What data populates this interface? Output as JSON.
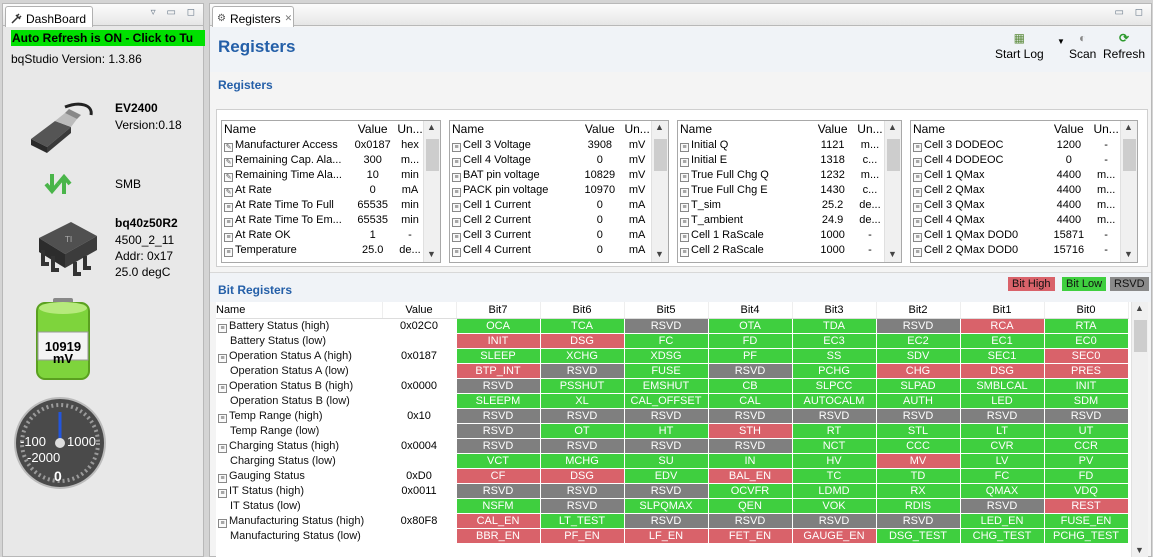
{
  "left": {
    "tab_label": "DashBoard",
    "auto_refresh": "Auto Refresh is ON - Click to Tu",
    "studio_version": "bqStudio Version: 1.3.86",
    "adapter": {
      "name": "EV2400",
      "version": "Version:0.18"
    },
    "bus": "SMB",
    "device": {
      "name": "bq40z50R2",
      "fw": "4500_2_11",
      "addr": "Addr: 0x17",
      "temp": "25.0 degC"
    },
    "voltage": {
      "value": "10919",
      "unit": "mV"
    },
    "current_gauge": {
      "left": "-100",
      "right": "1000",
      "bottom_label": "-2000",
      "value": "0"
    }
  },
  "right": {
    "tab_label": "Registers",
    "title": "Registers",
    "toolbar": {
      "start_log": "Start Log",
      "scan": "Scan",
      "refresh": "Refresh"
    },
    "registers_section": "Registers",
    "col_headers": {
      "name": "Name",
      "value": "Value",
      "unit": "Un..."
    },
    "reg_tables": [
      {
        "rows": [
          {
            "name": "Manufacturer Access",
            "value": "0x0187",
            "unit": "hex",
            "icon": "edit"
          },
          {
            "name": "Remaining Cap. Ala...",
            "value": "300",
            "unit": "m...",
            "icon": "edit"
          },
          {
            "name": "Remaining Time Ala...",
            "value": "10",
            "unit": "min",
            "icon": "edit"
          },
          {
            "name": "At Rate",
            "value": "0",
            "unit": "mA",
            "icon": "edit"
          },
          {
            "name": "At Rate Time To Full",
            "value": "65535",
            "unit": "min",
            "icon": "ro"
          },
          {
            "name": "At Rate Time To Em...",
            "value": "65535",
            "unit": "min",
            "icon": "ro"
          },
          {
            "name": "At Rate OK",
            "value": "1",
            "unit": "-",
            "icon": "ro"
          },
          {
            "name": "Temperature",
            "value": "25.0",
            "unit": "de...",
            "icon": "ro"
          }
        ]
      },
      {
        "rows": [
          {
            "name": "Cell 3 Voltage",
            "value": "3908",
            "unit": "mV",
            "icon": "ro"
          },
          {
            "name": "Cell 4 Voltage",
            "value": "0",
            "unit": "mV",
            "icon": "ro"
          },
          {
            "name": "BAT pin voltage",
            "value": "10829",
            "unit": "mV",
            "icon": "ro"
          },
          {
            "name": "PACK pin voltage",
            "value": "10970",
            "unit": "mV",
            "icon": "ro"
          },
          {
            "name": "Cell 1 Current",
            "value": "0",
            "unit": "mA",
            "icon": "ro"
          },
          {
            "name": "Cell 2 Current",
            "value": "0",
            "unit": "mA",
            "icon": "ro"
          },
          {
            "name": "Cell 3 Current",
            "value": "0",
            "unit": "mA",
            "icon": "ro"
          },
          {
            "name": "Cell 4 Current",
            "value": "0",
            "unit": "mA",
            "icon": "ro"
          }
        ]
      },
      {
        "rows": [
          {
            "name": "Initial Q",
            "value": "1121",
            "unit": "m...",
            "icon": "ro"
          },
          {
            "name": "Initial E",
            "value": "1318",
            "unit": "c...",
            "icon": "ro"
          },
          {
            "name": "True Full Chg Q",
            "value": "1232",
            "unit": "m...",
            "icon": "ro"
          },
          {
            "name": "True Full Chg E",
            "value": "1430",
            "unit": "c...",
            "icon": "ro"
          },
          {
            "name": "T_sim",
            "value": "25.2",
            "unit": "de...",
            "icon": "ro"
          },
          {
            "name": "T_ambient",
            "value": "24.9",
            "unit": "de...",
            "icon": "ro"
          },
          {
            "name": "Cell 1 RaScale",
            "value": "1000",
            "unit": "-",
            "icon": "ro"
          },
          {
            "name": "Cell 2 RaScale",
            "value": "1000",
            "unit": "-",
            "icon": "ro"
          }
        ]
      },
      {
        "rows": [
          {
            "name": "Cell 3 DODEOC",
            "value": "1200",
            "unit": "-",
            "icon": "ro"
          },
          {
            "name": "Cell 4 DODEOC",
            "value": "0",
            "unit": "-",
            "icon": "ro"
          },
          {
            "name": "Cell 1 QMax",
            "value": "4400",
            "unit": "m...",
            "icon": "ro"
          },
          {
            "name": "Cell 2 QMax",
            "value": "4400",
            "unit": "m...",
            "icon": "ro"
          },
          {
            "name": "Cell 3 QMax",
            "value": "4400",
            "unit": "m...",
            "icon": "ro"
          },
          {
            "name": "Cell 4 QMax",
            "value": "4400",
            "unit": "m...",
            "icon": "ro"
          },
          {
            "name": "Cell 1 QMax DOD0",
            "value": "15871",
            "unit": "-",
            "icon": "ro"
          },
          {
            "name": "Cell 2 QMax DOD0",
            "value": "15716",
            "unit": "-",
            "icon": "ro"
          }
        ]
      }
    ],
    "bit_section": "Bit Registers",
    "legend": {
      "high": "Bit High",
      "low": "Bit Low",
      "rsvd": "RSVD",
      "colors": {
        "high": "#d9626a",
        "low": "#3fcf3f",
        "rsvd": "#7f7f7f"
      }
    },
    "bit_headers": [
      "Name",
      "Value",
      "Bit7",
      "Bit6",
      "Bit5",
      "Bit4",
      "Bit3",
      "Bit2",
      "Bit1",
      "Bit0"
    ],
    "bit_rows": [
      {
        "name": "Battery Status (high)",
        "value": "0x02C0",
        "top": true,
        "bits": [
          [
            "OCA",
            "g"
          ],
          [
            "TCA",
            "g"
          ],
          [
            "RSVD",
            "y"
          ],
          [
            "OTA",
            "g"
          ],
          [
            "TDA",
            "g"
          ],
          [
            "RSVD",
            "y"
          ],
          [
            "RCA",
            "r"
          ],
          [
            "RTA",
            "g"
          ]
        ]
      },
      {
        "name": "Battery Status (low)",
        "value": "",
        "top": false,
        "bits": [
          [
            "INIT",
            "r"
          ],
          [
            "DSG",
            "r"
          ],
          [
            "FC",
            "g"
          ],
          [
            "FD",
            "g"
          ],
          [
            "EC3",
            "g"
          ],
          [
            "EC2",
            "g"
          ],
          [
            "EC1",
            "g"
          ],
          [
            "EC0",
            "g"
          ]
        ]
      },
      {
        "name": "Operation Status A (high)",
        "value": "0x0187",
        "top": true,
        "bits": [
          [
            "SLEEP",
            "g"
          ],
          [
            "XCHG",
            "g"
          ],
          [
            "XDSG",
            "g"
          ],
          [
            "PF",
            "g"
          ],
          [
            "SS",
            "g"
          ],
          [
            "SDV",
            "g"
          ],
          [
            "SEC1",
            "g"
          ],
          [
            "SEC0",
            "r"
          ]
        ]
      },
      {
        "name": "Operation Status A (low)",
        "value": "",
        "top": false,
        "bits": [
          [
            "BTP_INT",
            "r"
          ],
          [
            "RSVD",
            "y"
          ],
          [
            "FUSE",
            "g"
          ],
          [
            "RSVD",
            "y"
          ],
          [
            "PCHG",
            "g"
          ],
          [
            "CHG",
            "r"
          ],
          [
            "DSG",
            "r"
          ],
          [
            "PRES",
            "r"
          ]
        ]
      },
      {
        "name": "Operation Status B (high)",
        "value": "0x0000",
        "top": true,
        "bits": [
          [
            "RSVD",
            "y"
          ],
          [
            "PSSHUT",
            "g"
          ],
          [
            "EMSHUT",
            "g"
          ],
          [
            "CB",
            "g"
          ],
          [
            "SLPCC",
            "g"
          ],
          [
            "SLPAD",
            "g"
          ],
          [
            "SMBLCAL",
            "g"
          ],
          [
            "INIT",
            "g"
          ]
        ]
      },
      {
        "name": "Operation Status B (low)",
        "value": "",
        "top": false,
        "bits": [
          [
            "SLEEPM",
            "g"
          ],
          [
            "XL",
            "g"
          ],
          [
            "CAL_OFFSET",
            "g"
          ],
          [
            "CAL",
            "g"
          ],
          [
            "AUTOCALM",
            "g"
          ],
          [
            "AUTH",
            "g"
          ],
          [
            "LED",
            "g"
          ],
          [
            "SDM",
            "g"
          ]
        ]
      },
      {
        "name": "Temp Range (high)",
        "value": "0x10",
        "top": true,
        "bits": [
          [
            "RSVD",
            "y"
          ],
          [
            "RSVD",
            "y"
          ],
          [
            "RSVD",
            "y"
          ],
          [
            "RSVD",
            "y"
          ],
          [
            "RSVD",
            "y"
          ],
          [
            "RSVD",
            "y"
          ],
          [
            "RSVD",
            "y"
          ],
          [
            "RSVD",
            "y"
          ]
        ]
      },
      {
        "name": "Temp Range (low)",
        "value": "",
        "top": false,
        "bits": [
          [
            "RSVD",
            "y"
          ],
          [
            "OT",
            "g"
          ],
          [
            "HT",
            "g"
          ],
          [
            "STH",
            "r"
          ],
          [
            "RT",
            "g"
          ],
          [
            "STL",
            "g"
          ],
          [
            "LT",
            "g"
          ],
          [
            "UT",
            "g"
          ]
        ]
      },
      {
        "name": "Charging Status (high)",
        "value": "0x0004",
        "top": true,
        "bits": [
          [
            "RSVD",
            "y"
          ],
          [
            "RSVD",
            "y"
          ],
          [
            "RSVD",
            "y"
          ],
          [
            "RSVD",
            "y"
          ],
          [
            "NCT",
            "g"
          ],
          [
            "CCC",
            "g"
          ],
          [
            "CVR",
            "g"
          ],
          [
            "CCR",
            "g"
          ]
        ]
      },
      {
        "name": "Charging Status (low)",
        "value": "",
        "top": false,
        "bits": [
          [
            "VCT",
            "g"
          ],
          [
            "MCHG",
            "g"
          ],
          [
            "SU",
            "g"
          ],
          [
            "IN",
            "g"
          ],
          [
            "HV",
            "g"
          ],
          [
            "MV",
            "r"
          ],
          [
            "LV",
            "g"
          ],
          [
            "PV",
            "g"
          ]
        ]
      },
      {
        "name": "Gauging Status",
        "value": "0xD0",
        "top": true,
        "bits": [
          [
            "CF",
            "r"
          ],
          [
            "DSG",
            "r"
          ],
          [
            "EDV",
            "g"
          ],
          [
            "BAL_EN",
            "r"
          ],
          [
            "TC",
            "g"
          ],
          [
            "TD",
            "g"
          ],
          [
            "FC",
            "g"
          ],
          [
            "FD",
            "g"
          ]
        ]
      },
      {
        "name": "IT Status (high)",
        "value": "0x0011",
        "top": true,
        "bits": [
          [
            "RSVD",
            "y"
          ],
          [
            "RSVD",
            "y"
          ],
          [
            "RSVD",
            "y"
          ],
          [
            "OCVFR",
            "g"
          ],
          [
            "LDMD",
            "g"
          ],
          [
            "RX",
            "g"
          ],
          [
            "QMAX",
            "g"
          ],
          [
            "VDQ",
            "g"
          ]
        ]
      },
      {
        "name": "IT Status (low)",
        "value": "",
        "top": false,
        "bits": [
          [
            "NSFM",
            "g"
          ],
          [
            "RSVD",
            "y"
          ],
          [
            "SLPQMAX",
            "g"
          ],
          [
            "QEN",
            "g"
          ],
          [
            "VOK",
            "g"
          ],
          [
            "RDIS",
            "g"
          ],
          [
            "RSVD",
            "y"
          ],
          [
            "REST",
            "r"
          ]
        ]
      },
      {
        "name": "Manufacturing Status (high)",
        "value": "0x80F8",
        "top": true,
        "bits": [
          [
            "CAL_EN",
            "r"
          ],
          [
            "LT_TEST",
            "g"
          ],
          [
            "RSVD",
            "y"
          ],
          [
            "RSVD",
            "y"
          ],
          [
            "RSVD",
            "y"
          ],
          [
            "RSVD",
            "y"
          ],
          [
            "LED_EN",
            "g"
          ],
          [
            "FUSE_EN",
            "g"
          ]
        ]
      },
      {
        "name": "Manufacturing Status (low)",
        "value": "",
        "top": false,
        "bits": [
          [
            "BBR_EN",
            "r"
          ],
          [
            "PF_EN",
            "r"
          ],
          [
            "LF_EN",
            "r"
          ],
          [
            "FET_EN",
            "r"
          ],
          [
            "GAUGE_EN",
            "r"
          ],
          [
            "DSG_TEST",
            "g"
          ],
          [
            "CHG_TEST",
            "g"
          ],
          [
            "PCHG_TEST",
            "g"
          ]
        ]
      }
    ]
  }
}
